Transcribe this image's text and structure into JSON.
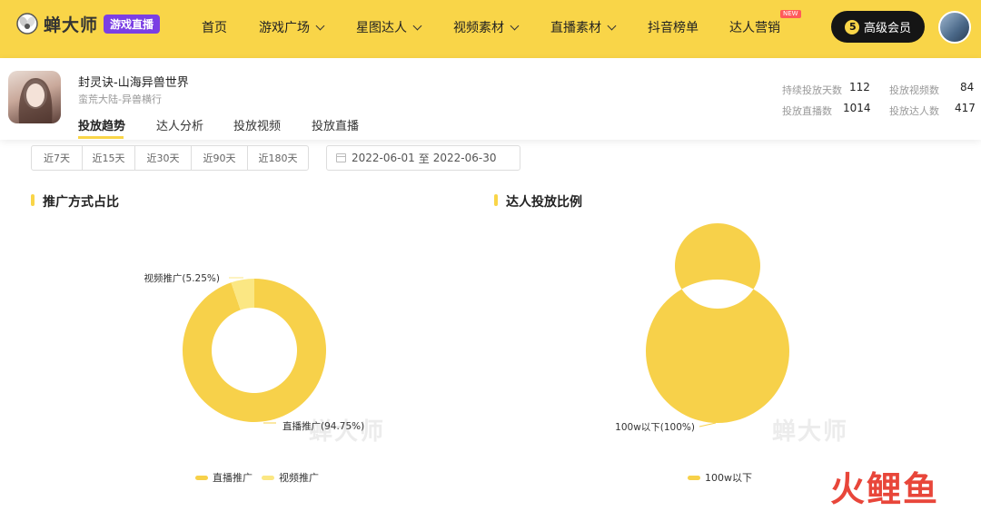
{
  "brand": {
    "name": "蝉大师",
    "badge": "游戏直播"
  },
  "nav": {
    "items": [
      {
        "label": "首页",
        "has_dropdown": false
      },
      {
        "label": "游戏广场",
        "has_dropdown": true
      },
      {
        "label": "星图达人",
        "has_dropdown": true
      },
      {
        "label": "视频素材",
        "has_dropdown": true
      },
      {
        "label": "直播素材",
        "has_dropdown": true
      },
      {
        "label": "抖音榜单",
        "has_dropdown": false
      },
      {
        "label": "达人营销",
        "has_dropdown": false,
        "badge": "NEW"
      }
    ],
    "vip_label": "高级会员"
  },
  "game": {
    "title": "封灵诀-山海异兽世界",
    "subtitle": "蛮荒大陆-异兽横行",
    "tabs": [
      "投放趋势",
      "达人分析",
      "投放视频",
      "投放直播"
    ],
    "active_tab": 0,
    "stats": [
      {
        "label": "持续投放天数",
        "value": "112"
      },
      {
        "label": "投放视频数",
        "value": "84"
      },
      {
        "label": "投放直播数",
        "value": "1014"
      },
      {
        "label": "投放达人数",
        "value": "417"
      }
    ]
  },
  "filters": {
    "ranges": [
      "近7天",
      "近15天",
      "近30天",
      "近90天",
      "近180天"
    ],
    "date_start": "2022-06-01",
    "date_sep": "至",
    "date_end": "2022-06-30"
  },
  "sections": {
    "left_title": "推广方式占比",
    "right_title": "达人投放比例"
  },
  "watermark": "蝉大师",
  "corner_brand": "火鲤鱼",
  "colors": {
    "accent": "#f9d548",
    "light_series": "#fbe783",
    "vip_bg": "#151515",
    "badge_purple": "#7b3fe4",
    "corner_red": "#e8463a",
    "corner_blue": "#3a74c8"
  },
  "chart_data": [
    {
      "type": "pie",
      "donut": true,
      "title": "推广方式占比",
      "categories": [
        "直播推广",
        "视频推广"
      ],
      "values": [
        94.75,
        5.25
      ],
      "labels": [
        "直播推广(94.75%)",
        "视频推广(5.25%)"
      ],
      "colors": [
        "#f7d14a",
        "#fbe783"
      ],
      "legend": [
        "直播推广",
        "视频推广"
      ],
      "legend_placement": "bottom"
    },
    {
      "type": "pie",
      "donut": true,
      "title": "达人投放比例",
      "categories": [
        "100w以下"
      ],
      "values": [
        100
      ],
      "labels": [
        "100w以下(100%)"
      ],
      "colors": [
        "#f7d14a"
      ],
      "legend": [
        "100w以下"
      ],
      "legend_placement": "bottom"
    }
  ]
}
